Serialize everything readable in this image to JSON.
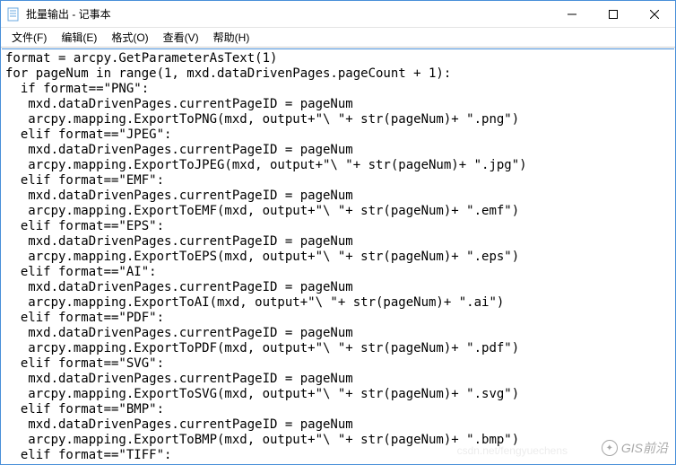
{
  "window": {
    "title": "批量输出 - 记事本"
  },
  "menu": {
    "file": "文件(F)",
    "edit": "编辑(E)",
    "format": "格式(O)",
    "view": "查看(V)",
    "help": "帮助(H)"
  },
  "editor": {
    "content": "format = arcpy.GetParameterAsText(1)\nfor pageNum in range(1, mxd.dataDrivenPages.pageCount + 1):\n  if format==\"PNG\":\n   mxd.dataDrivenPages.currentPageID = pageNum\n   arcpy.mapping.ExportToPNG(mxd, output+\"\\ \"+ str(pageNum)+ \".png\")\n  elif format==\"JPEG\":\n   mxd.dataDrivenPages.currentPageID = pageNum\n   arcpy.mapping.ExportToJPEG(mxd, output+\"\\ \"+ str(pageNum)+ \".jpg\")\n  elif format==\"EMF\":\n   mxd.dataDrivenPages.currentPageID = pageNum\n   arcpy.mapping.ExportToEMF(mxd, output+\"\\ \"+ str(pageNum)+ \".emf\")\n  elif format==\"EPS\":\n   mxd.dataDrivenPages.currentPageID = pageNum\n   arcpy.mapping.ExportToEPS(mxd, output+\"\\ \"+ str(pageNum)+ \".eps\")\n  elif format==\"AI\":\n   mxd.dataDrivenPages.currentPageID = pageNum\n   arcpy.mapping.ExportToAI(mxd, output+\"\\ \"+ str(pageNum)+ \".ai\")\n  elif format==\"PDF\":\n   mxd.dataDrivenPages.currentPageID = pageNum\n   arcpy.mapping.ExportToPDF(mxd, output+\"\\ \"+ str(pageNum)+ \".pdf\")\n  elif format==\"SVG\":\n   mxd.dataDrivenPages.currentPageID = pageNum\n   arcpy.mapping.ExportToSVG(mxd, output+\"\\ \"+ str(pageNum)+ \".svg\")\n  elif format==\"BMP\":\n   mxd.dataDrivenPages.currentPageID = pageNum\n   arcpy.mapping.ExportToBMP(mxd, output+\"\\ \"+ str(pageNum)+ \".bmp\")\n  elif format==\"TIFF\":\n   mxd.dataDrivenPages.currentPageID = pageNum\n   arcpy.mapping.ExportToTIFF(mxd, output+\"\\ \"+ str(pageNum)+ \".tiff\")"
  },
  "watermark": {
    "main": "GIS前沿",
    "faint": "csdn.net/fengyuechens"
  }
}
